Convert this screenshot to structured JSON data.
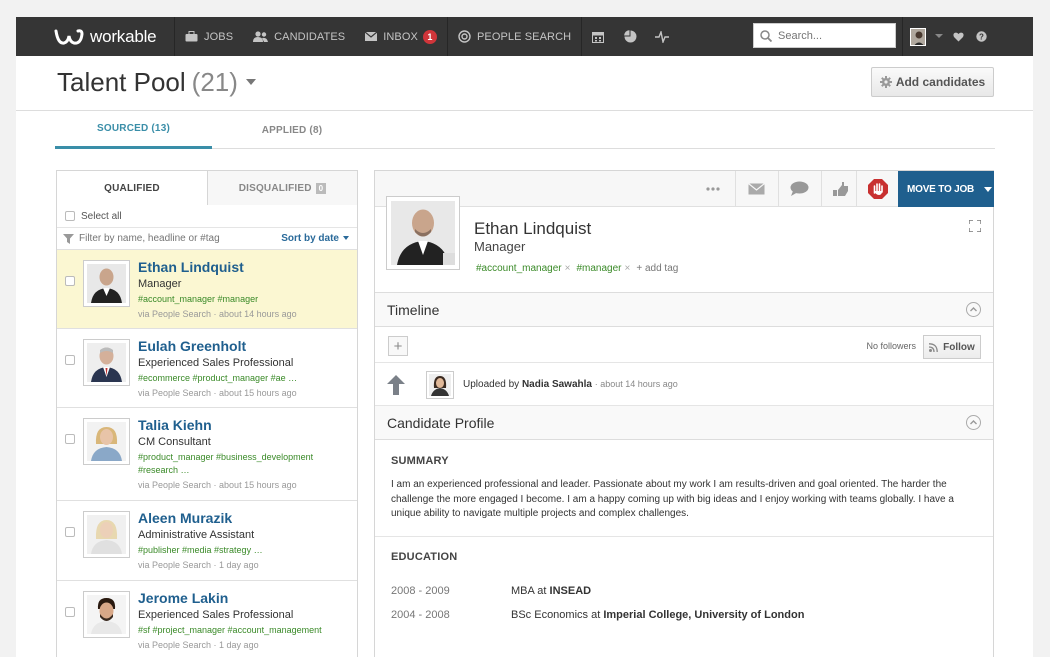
{
  "nav": {
    "brand": "workable",
    "items": [
      {
        "label": "JOBS",
        "icon": "briefcase-icon"
      },
      {
        "label": "CANDIDATES",
        "icon": "users-icon"
      },
      {
        "label": "INBOX",
        "icon": "envelope-icon",
        "badge": "1"
      },
      {
        "label": "PEOPLE SEARCH",
        "icon": "target-icon"
      }
    ],
    "tools": [
      "calendar-icon",
      "pie-chart-icon",
      "pulse-icon"
    ],
    "search_placeholder": "Search...",
    "right_icons": [
      "user-avatar",
      "chevron-down-icon",
      "heart-icon",
      "help-icon"
    ]
  },
  "header": {
    "title": "Talent Pool",
    "count": "(21)",
    "add_button": "Add candidates"
  },
  "tabs": [
    {
      "label": "SOURCED (13)",
      "active": true
    },
    {
      "label": "APPLIED (8)",
      "active": false
    }
  ],
  "left_panel": {
    "subtabs": {
      "qualified": "QUALIFIED",
      "disqualified": "DISQUALIFIED",
      "disqualified_count": "0"
    },
    "select_all": "Select all",
    "filter_placeholder": "Filter by name, headline or #tag",
    "sort_label": "Sort by date",
    "candidates": [
      {
        "name": "Ethan Lindquist",
        "headline": "Manager",
        "tags": "#account_manager  #manager",
        "via": "via People Search · about 14 hours ago",
        "selected": true
      },
      {
        "name": "Eulah Greenholt",
        "headline": "Experienced Sales Professional",
        "tags": "#ecommerce  #product_manager  #ae  …",
        "via": "via People Search · about 15 hours ago",
        "selected": false
      },
      {
        "name": "Talia Kiehn",
        "headline": "CM Consultant",
        "tags": "#product_manager  #business_development  #research  …",
        "via": "via People Search · about 15 hours ago",
        "selected": false
      },
      {
        "name": "Aleen Murazik",
        "headline": "Administrative Assistant",
        "tags": "#publisher  #media  #strategy  …",
        "via": "via People Search · 1 day ago",
        "selected": false
      },
      {
        "name": "Jerome Lakin",
        "headline": "Experienced Sales Professional",
        "tags": "#sf  #project_manager  #account_management",
        "via": "via People Search · 1 day ago",
        "selected": false
      }
    ]
  },
  "right_panel": {
    "toolbar": {
      "move_button": "MOVE TO JOB"
    },
    "profile": {
      "name": "Ethan Lindquist",
      "headline": "Manager",
      "tags": [
        "#account_manager",
        "#manager"
      ],
      "add_tag": "add tag"
    },
    "timeline": {
      "title": "Timeline",
      "followers": "No followers",
      "follow_button": "Follow",
      "event_prefix": "Uploaded by",
      "event_user": "Nadia Sawahla",
      "event_time": "· about 14 hours ago"
    },
    "candidate_profile": {
      "title": "Candidate Profile",
      "summary_title": "SUMMARY",
      "summary_text": "I am an experienced professional and leader. Passionate about my work I am results-driven and goal oriented. The harder the challenge the more engaged I become. I am a happy coming up with big ideas and I enjoy working with teams globally. I have a unique ability to navigate multiple projects and complex challenges.",
      "education_title": "EDUCATION",
      "education": [
        {
          "years": "2008 - 2009",
          "degree": "MBA at",
          "school": "INSEAD"
        },
        {
          "years": "2004 - 2008",
          "degree": "BSc Economics at",
          "school": "Imperial College, University of London"
        }
      ]
    }
  }
}
